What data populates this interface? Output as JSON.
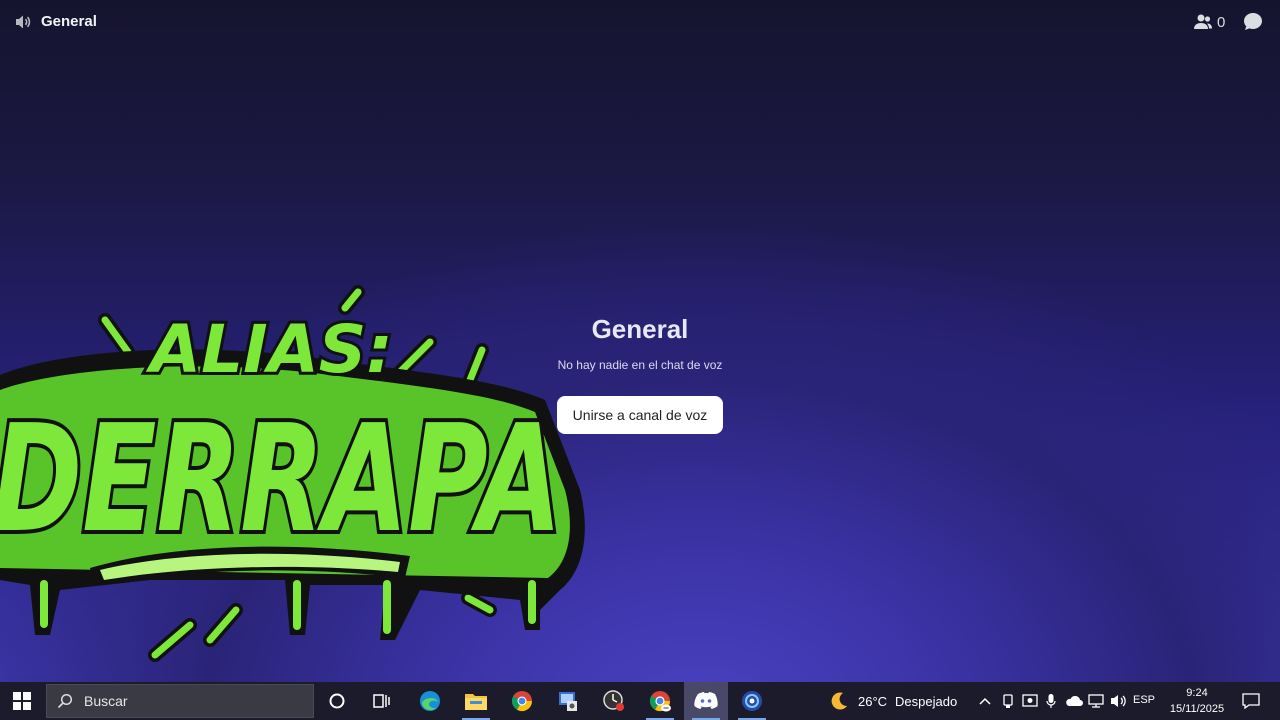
{
  "header": {
    "channel_title": "General",
    "member_count": "0"
  },
  "voice": {
    "title": "General",
    "subtitle": "No hay nadie en el chat de voz",
    "join_label": "Unirse a canal de voz"
  },
  "logo": {
    "line1": "ALIAS:",
    "line2": "DERRAPA"
  },
  "taskbar": {
    "search_placeholder": "Buscar",
    "weather": {
      "temp": "26°C",
      "condition": "Despejado"
    },
    "language": "ESP",
    "time": "9:24",
    "date": "15/11/2025",
    "apps": [
      "cortana-icon",
      "task-view-icon",
      "edge-icon",
      "file-explorer-icon",
      "chrome-icon",
      "control-panel-icon",
      "clock-app-icon",
      "chrome-profile-icon",
      "discord-icon",
      "browser-app-icon"
    ]
  },
  "colors": {
    "accent_green": "#7ee83a",
    "join_bg": "#ffffff",
    "taskbar": "#1c1b2b"
  }
}
